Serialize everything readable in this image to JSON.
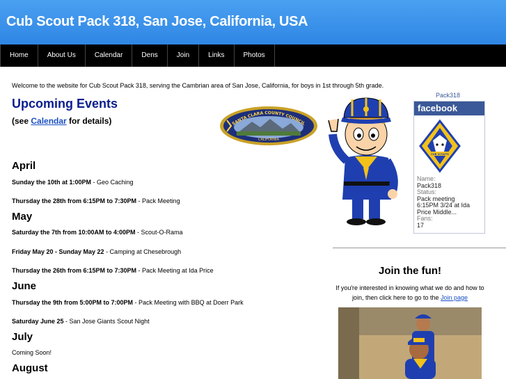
{
  "header": {
    "title": "Cub Scout Pack 318, San Jose, California, USA"
  },
  "nav": {
    "items": [
      "Home",
      "About Us",
      "Calendar",
      "Dens",
      "Join",
      "Links",
      "Photos"
    ]
  },
  "welcome": "Welcome to the website for Cub Scout Pack 318, serving the Cambrian area of San Jose, California, for boys in 1st through 5th grade.",
  "upcoming": {
    "title": "Upcoming Events",
    "see_prefix": "(see ",
    "see_link": "Calendar",
    "see_suffix": " for details)"
  },
  "badge": {
    "top_text": "SANTA CLARA COUNTY COUNCIL",
    "bottom_text": "CALIFORNIA"
  },
  "months": [
    {
      "name": "April",
      "events": [
        {
          "when": "Sunday the 10th at 1:00PM",
          "what": " - Geo Caching"
        },
        {
          "when": "Thursday the 28th from 6:15PM to 7:30PM",
          "what": " - Pack Meeting"
        }
      ]
    },
    {
      "name": "May",
      "events": [
        {
          "when": "Saturday the 7th from 10:00AM to 4:00PM",
          "what": " - Scout-O-Rama"
        },
        {
          "when": "Friday May 20 - Sunday May 22",
          "what": " - Camping at Chesebrough"
        },
        {
          "when": "Thursday the 26th from 6:15PM to 7:30PM",
          "what": " - Pack Meeting at Ida Price"
        }
      ]
    },
    {
      "name": "June",
      "events": [
        {
          "when": "Thursday the 9th from 5:00PM to 7:00PM",
          "what": " - Pack Meeting with BBQ at Doerr Park"
        },
        {
          "when": "Saturday June 25",
          "what": " - San Jose Giants Scout Night"
        }
      ]
    },
    {
      "name": "July",
      "events": [
        {
          "when": "",
          "what": "Coming Soon!"
        }
      ]
    },
    {
      "name": "August",
      "events": []
    }
  ],
  "facebook": {
    "link": "Pack318",
    "brand": "facebook",
    "name_label": "Name:",
    "name": "Pack318",
    "status_label": "Status:",
    "status_lines": [
      "Pack meeting",
      "6:15PM 3/24 at Ida",
      "Price Middle..."
    ],
    "fans_label": "Fans:",
    "fans": "17",
    "logo_text": "CUB SCOUTS"
  },
  "join": {
    "title": "Join the fun!",
    "text_before": "If you're interested in knowing what we do and how to join, then click here to go to the ",
    "link": "Join page"
  },
  "colors": {
    "header_blue": "#2f86e4",
    "heading_blue": "#0a1e8c",
    "link_blue": "#1a4fc4",
    "facebook_blue": "#3b5998"
  }
}
